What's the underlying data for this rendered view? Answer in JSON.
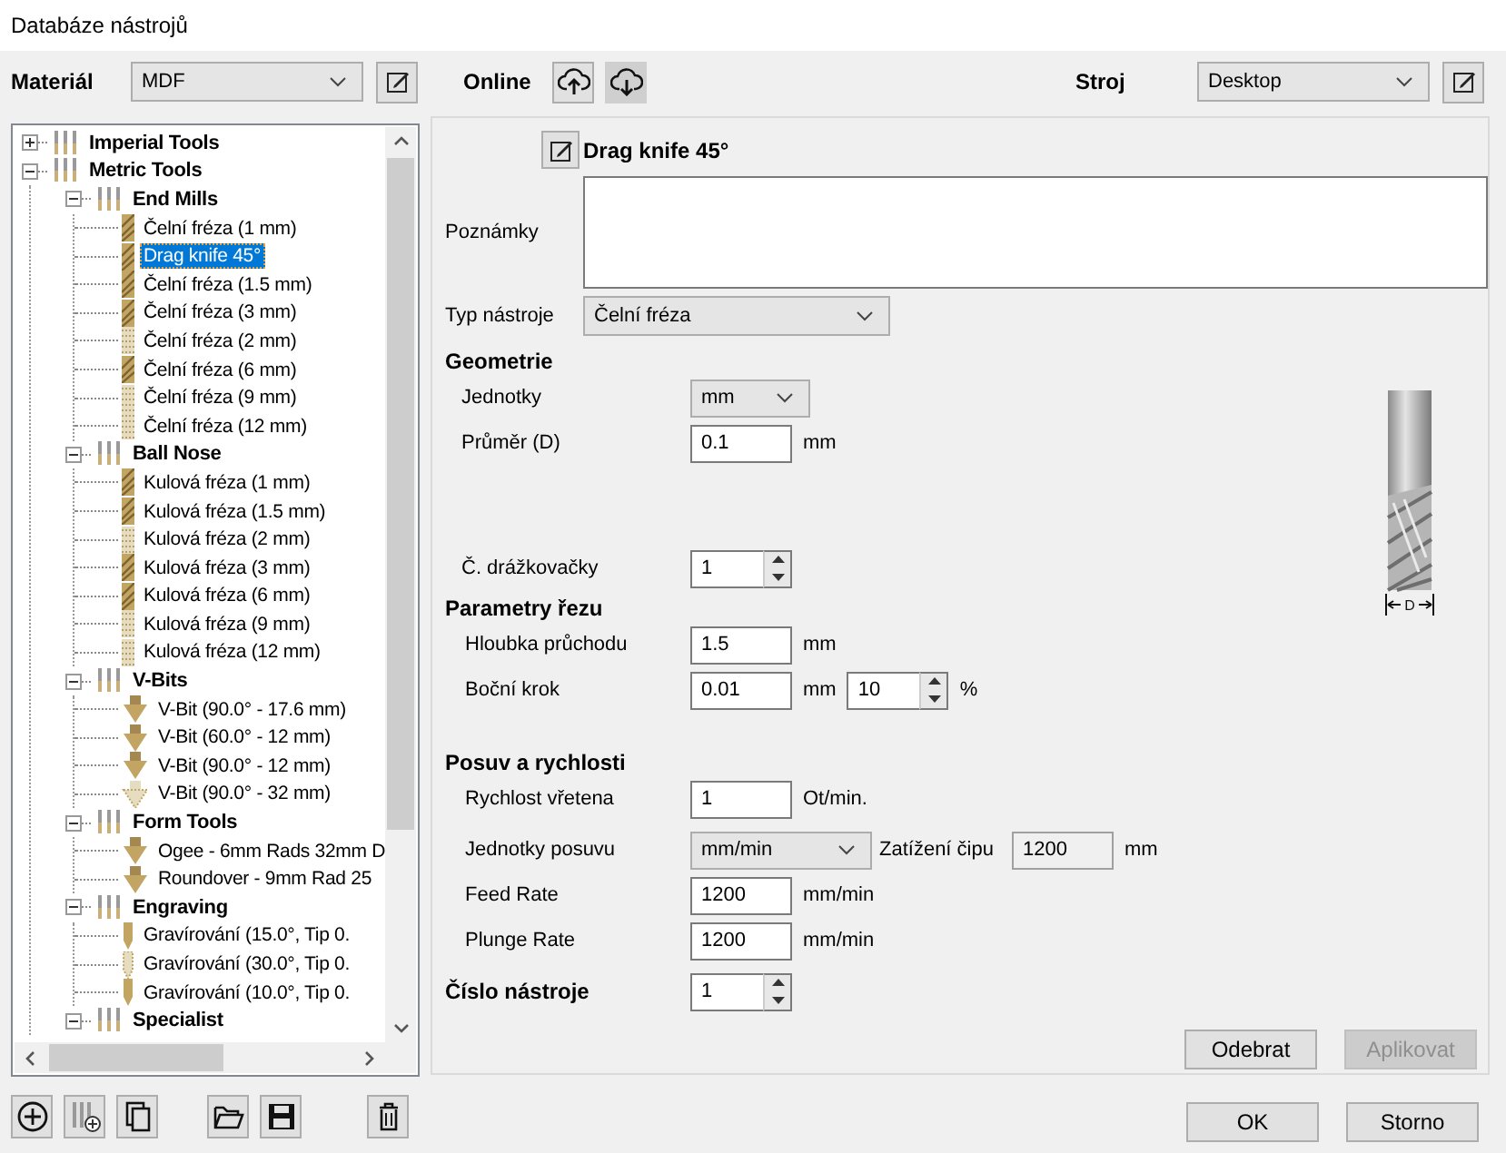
{
  "window": {
    "title": "Databáze nástrojů"
  },
  "toolbar": {
    "material_label": "Materiál",
    "material": "MDF",
    "online_label": "Online",
    "machine_label": "Stroj",
    "machine": "Desktop"
  },
  "tree": {
    "items": [
      {
        "label": "Imperial Tools",
        "kind": "group",
        "expanded": false,
        "selected": false
      },
      {
        "label": "Metric Tools",
        "kind": "group",
        "expanded": true,
        "selected": false,
        "children": [
          {
            "label": "End Mills",
            "kind": "group",
            "expanded": true,
            "selected": false,
            "children": [
              {
                "label": "Čelní fréza (1 mm)",
                "kind": "mill",
                "selected": false
              },
              {
                "label": "Drag knife 45°",
                "kind": "mill",
                "selected": true
              },
              {
                "label": "Čelní fréza (1.5 mm)",
                "kind": "mill",
                "selected": false
              },
              {
                "label": "Čelní fréza (3 mm)",
                "kind": "mill",
                "selected": false
              },
              {
                "label": "Čelní fréza (2 mm)",
                "kind": "mill-hatched",
                "selected": false
              },
              {
                "label": "Čelní fréza (6 mm)",
                "kind": "mill",
                "selected": false
              },
              {
                "label": "Čelní fréza (9 mm)",
                "kind": "mill-hatched",
                "selected": false
              },
              {
                "label": "Čelní fréza (12 mm)",
                "kind": "mill-hatched",
                "selected": false
              }
            ]
          },
          {
            "label": "Ball Nose",
            "kind": "group",
            "expanded": true,
            "selected": false,
            "children": [
              {
                "label": "Kulová fréza (1 mm)",
                "kind": "mill",
                "selected": false
              },
              {
                "label": "Kulová fréza (1.5 mm)",
                "kind": "mill",
                "selected": false
              },
              {
                "label": "Kulová fréza (2 mm)",
                "kind": "mill-hatched",
                "selected": false
              },
              {
                "label": "Kulová fréza (3 mm)",
                "kind": "mill",
                "selected": false
              },
              {
                "label": "Kulová fréza (6 mm)",
                "kind": "mill",
                "selected": false
              },
              {
                "label": "Kulová fréza (9 mm)",
                "kind": "mill-hatched",
                "selected": false
              },
              {
                "label": "Kulová fréza (12 mm)",
                "kind": "mill-hatched",
                "selected": false
              }
            ]
          },
          {
            "label": "V-Bits",
            "kind": "group",
            "expanded": true,
            "selected": false,
            "children": [
              {
                "label": "V-Bit (90.0° - 17.6 mm)",
                "kind": "vbit",
                "selected": false
              },
              {
                "label": "V-Bit (60.0° - 12 mm)",
                "kind": "vbit",
                "selected": false
              },
              {
                "label": "V-Bit (90.0° - 12 mm)",
                "kind": "vbit",
                "selected": false
              },
              {
                "label": "V-Bit (90.0° - 32 mm)",
                "kind": "vbit-hatched",
                "selected": false
              }
            ]
          },
          {
            "label": "Form Tools",
            "kind": "group",
            "expanded": true,
            "selected": false,
            "children": [
              {
                "label": "Ogee - 6mm Rads 32mm D",
                "kind": "vbit",
                "selected": false
              },
              {
                "label": "Roundover -  9mm Rad 25",
                "kind": "vbit",
                "selected": false
              }
            ]
          },
          {
            "label": "Engraving",
            "kind": "group",
            "expanded": true,
            "selected": false,
            "children": [
              {
                "label": "Gravírování (15.0°, Tip 0.",
                "kind": "engraver",
                "selected": false
              },
              {
                "label": "Gravírování (30.0°, Tip 0.",
                "kind": "engraver-hatched",
                "selected": false
              },
              {
                "label": "Gravírování (10.0°, Tip 0.",
                "kind": "engraver",
                "selected": false
              }
            ]
          },
          {
            "label": "Specialist",
            "kind": "group",
            "expanded": true,
            "selected": false
          }
        ]
      }
    ]
  },
  "tool": {
    "name": "Drag knife 45°",
    "notes_label": "Poznámky",
    "type_label": "Typ nástroje",
    "type": "Čelní fréza",
    "dimension_label": "D"
  },
  "form_sections": [
    {
      "heading": "Geometrie",
      "rows": [
        {
          "label": "Jednotky",
          "kind": "select",
          "value": "mm"
        },
        {
          "label": "Průměr (D)",
          "kind": "input",
          "value": "0.1",
          "unit": "mm"
        },
        {
          "label": "Č. drážkovačky",
          "kind": "spin",
          "value": "1"
        }
      ]
    },
    {
      "heading": "Parametry řezu",
      "rows": [
        {
          "label": "Hloubka průchodu",
          "kind": "input",
          "value": "1.5",
          "unit": "mm"
        },
        {
          "label": "Boční krok",
          "kind": "input",
          "value": "0.01",
          "unit": "mm",
          "extra": {
            "kind": "spin",
            "value": "10",
            "unit": "%"
          }
        }
      ]
    },
    {
      "heading": "Posuv a rychlosti",
      "rows": [
        {
          "label": "Rychlost vřetena",
          "kind": "input",
          "value": "1",
          "unit": "Ot/min."
        },
        {
          "label": "Jednotky posuvu",
          "kind": "select",
          "value": "mm/min",
          "extra": {
            "label": "Zatížení čipu",
            "kind": "input",
            "value": "1200",
            "unit": "mm",
            "readonly": true
          }
        },
        {
          "label": "Feed Rate",
          "kind": "input",
          "value": "1200",
          "unit": "mm/min"
        },
        {
          "label": "Plunge Rate",
          "kind": "input",
          "value": "1200",
          "unit": "mm/min"
        }
      ]
    }
  ],
  "tool_number": {
    "label": "Číslo nástroje",
    "value": "1"
  },
  "panel_buttons": [
    {
      "label": "Odebrat",
      "disabled": false
    },
    {
      "label": "Aplikovat",
      "disabled": true
    }
  ],
  "dialog_buttons": [
    {
      "label": "OK"
    },
    {
      "label": "Storno"
    }
  ]
}
